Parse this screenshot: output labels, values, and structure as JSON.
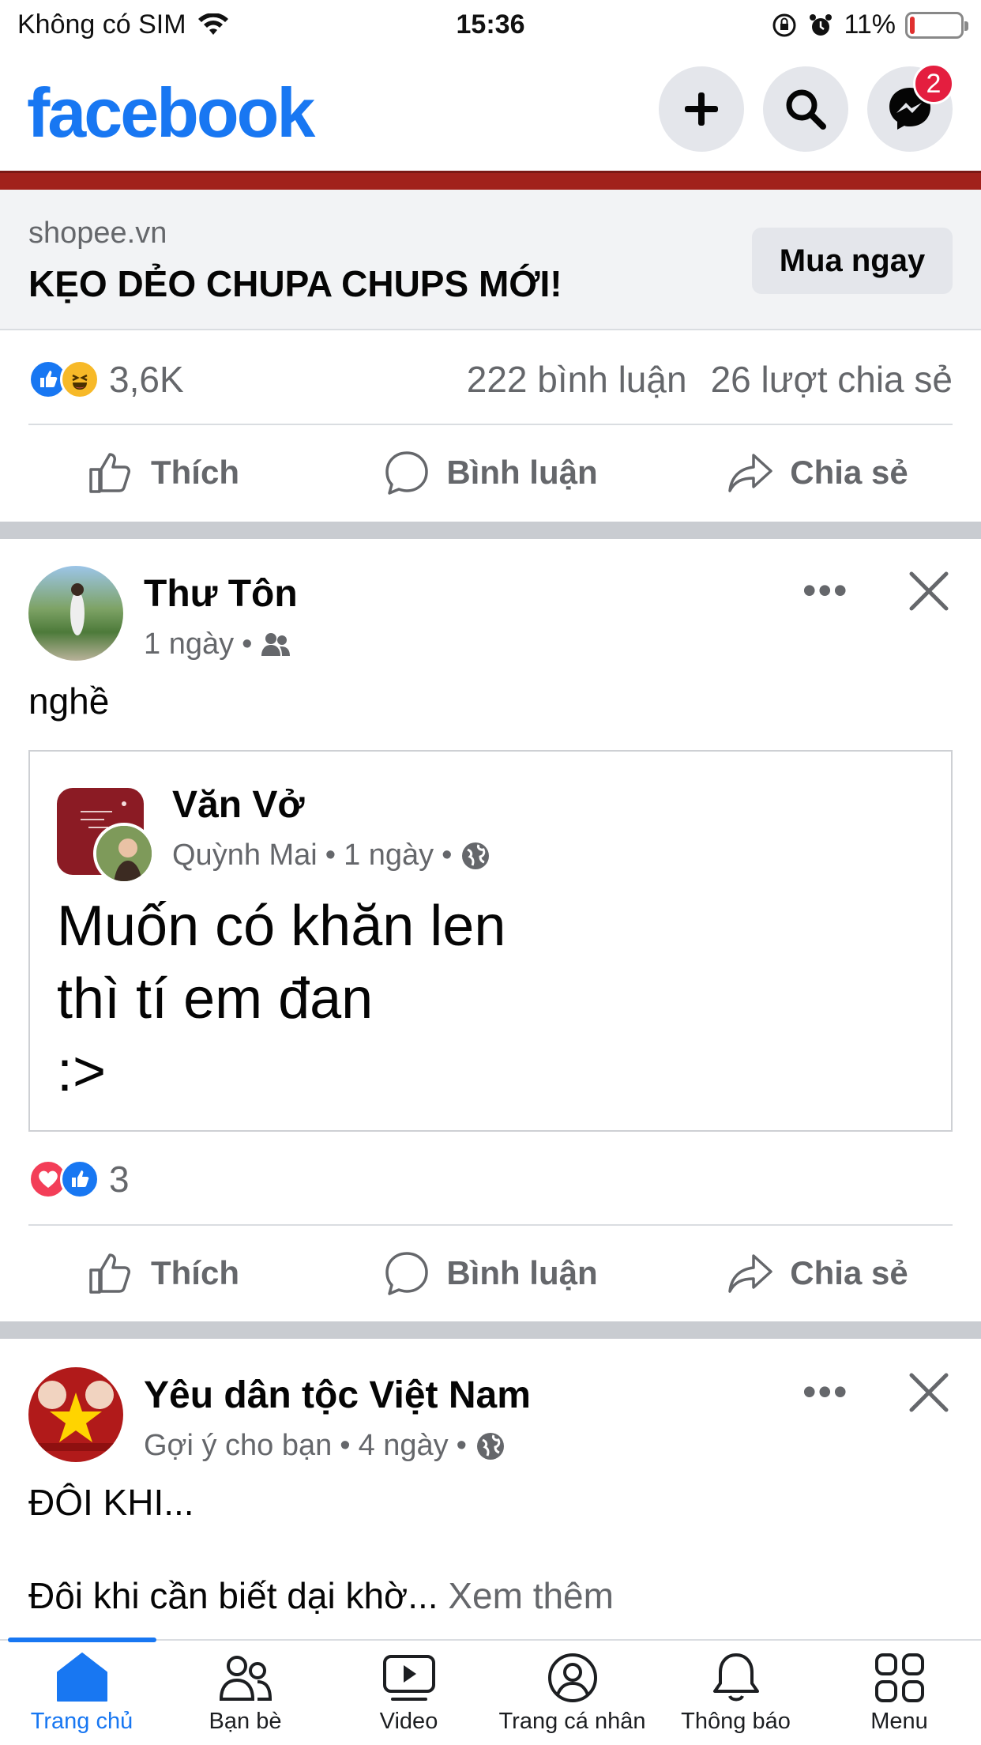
{
  "status_bar": {
    "carrier": "Không có SIM",
    "time": "15:36",
    "battery": "11%",
    "battery_level": 0.11
  },
  "header": {
    "logo": "facebook",
    "messenger_badge": "2"
  },
  "ad": {
    "domain": "shopee.vn",
    "title": "KẸO DẺO CHUPA CHUPS MỚI!",
    "cta": "Mua ngay",
    "reactions_count": "3,6K",
    "comments": "222 bình luận",
    "shares": "26 lượt chia sẻ"
  },
  "actions": {
    "like": "Thích",
    "comment": "Bình luận",
    "share": "Chia sẻ"
  },
  "post1": {
    "author": "Thư Tôn",
    "time": "1 ngày",
    "sep": "•",
    "text": "nghề",
    "shared": {
      "page": "Văn Vở",
      "author": "Quỳnh Mai",
      "time": "1 ngày",
      "sep1": "•",
      "sep2": "•",
      "line1": "Muốn có khăn len",
      "line2": "thì tí em đan",
      "line3": ":>"
    },
    "reactions_count": "3"
  },
  "post2": {
    "author": "Yêu dân tộc Việt Nam",
    "meta": "Gợi ý cho bạn",
    "time": "4 ngày",
    "sep1": "•",
    "sep2": "•",
    "line1": "ĐÔI KHI...",
    "line2": "Đôi khi cần biết dại khờ...",
    "see_more": "Xem thêm"
  },
  "tabs": [
    {
      "label": "Trang chủ",
      "icon": "home-icon"
    },
    {
      "label": "Bạn bè",
      "icon": "friends-icon"
    },
    {
      "label": "Video",
      "icon": "video-icon"
    },
    {
      "label": "Trang cá nhân",
      "icon": "profile-icon"
    },
    {
      "label": "Thông báo",
      "icon": "bell-icon"
    },
    {
      "label": "Menu",
      "icon": "menu-icon"
    }
  ],
  "colors": {
    "brand": "#1877f2",
    "badge": "#e41e3f",
    "ad_banner": "#a1211b"
  }
}
